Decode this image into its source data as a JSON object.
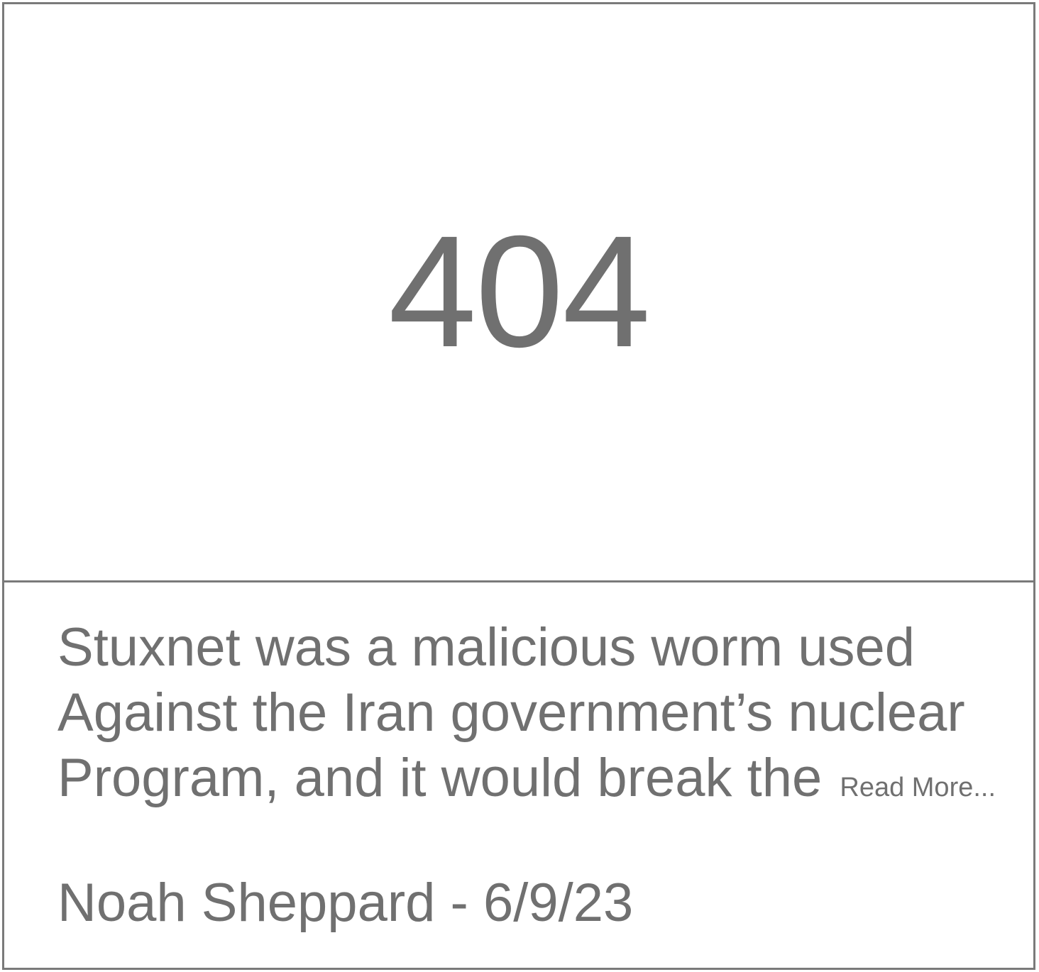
{
  "card": {
    "image_placeholder": "404",
    "excerpt_lines": [
      "Stuxnet was a malicious worm used",
      "Against the Iran government’s nuclear",
      "Program, and it would break the"
    ],
    "read_more_label": "Read More...",
    "author": "Noah Sheppard",
    "separator": " - ",
    "date": "6/9/23"
  },
  "colors": {
    "text": "#707070",
    "border": "#7a7a7a",
    "background": "#ffffff"
  }
}
